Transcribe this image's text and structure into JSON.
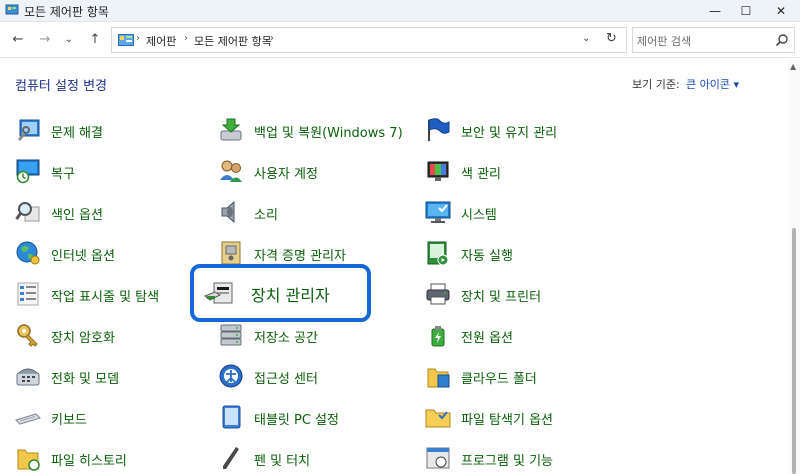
{
  "window": {
    "title": "모든 제어판 항목",
    "controls": {
      "minimize": "—",
      "maximize": "☐",
      "close": "✕"
    }
  },
  "nav": {
    "back": "←",
    "forward": "→",
    "recent": "⌄",
    "up": "↑"
  },
  "address": {
    "crumbs": [
      "제어판",
      "모든 제어판 항목"
    ],
    "separator": "›",
    "dropdown": "⌄",
    "refresh": "↻"
  },
  "search": {
    "placeholder": "제어판 검색"
  },
  "header": {
    "title": "컴퓨터 설정 변경",
    "viewby_label": "보기 기준:",
    "viewby_value": "큰 아이콘 ▾"
  },
  "items": {
    "col1": [
      {
        "label": "문제 해결",
        "icon": "troubleshoot-icon"
      },
      {
        "label": "복구",
        "icon": "recovery-icon"
      },
      {
        "label": "색인 옵션",
        "icon": "indexing-icon"
      },
      {
        "label": "인터넷 옵션",
        "icon": "internet-icon"
      },
      {
        "label": "작업 표시줄 및 탐색",
        "icon": "taskbar-icon"
      },
      {
        "label": "장치 암호화",
        "icon": "encryption-icon"
      },
      {
        "label": "전화 및 모뎀",
        "icon": "phone-icon"
      },
      {
        "label": "키보드",
        "icon": "keyboard-icon"
      },
      {
        "label": "파일 히스토리",
        "icon": "file-history-icon"
      }
    ],
    "col2": [
      {
        "label": "백업 및 복원(Windows 7)",
        "icon": "backup-icon"
      },
      {
        "label": "사용자 계정",
        "icon": "user-accounts-icon"
      },
      {
        "label": "소리",
        "icon": "sound-icon"
      },
      {
        "label": "자격 증명 관리자",
        "icon": "credential-icon"
      },
      {
        "label": "장치 관리자",
        "icon": "device-manager-icon"
      },
      {
        "label": "저장소 공간",
        "icon": "storage-icon"
      },
      {
        "label": "접근성 센터",
        "icon": "accessibility-icon"
      },
      {
        "label": "태블릿 PC 설정",
        "icon": "tablet-icon"
      },
      {
        "label": "펜 및 터치",
        "icon": "pen-icon"
      }
    ],
    "col3": [
      {
        "label": "보안 및 유지 관리",
        "icon": "security-flag-icon"
      },
      {
        "label": "색 관리",
        "icon": "color-management-icon"
      },
      {
        "label": "시스템",
        "icon": "system-icon"
      },
      {
        "label": "자동 실행",
        "icon": "autoplay-icon"
      },
      {
        "label": "장치 및 프린터",
        "icon": "printer-icon"
      },
      {
        "label": "전원 옵션",
        "icon": "power-icon"
      },
      {
        "label": "클라우드 폴더",
        "icon": "cloud-folder-icon"
      },
      {
        "label": "파일 탐색기 옵션",
        "icon": "folder-options-icon"
      },
      {
        "label": "프로그램 및 기능",
        "icon": "programs-icon"
      }
    ]
  },
  "colors": {
    "link_green": "#0b5e0b",
    "title_blue": "#1e3287",
    "highlight_blue": "#1468d8"
  }
}
